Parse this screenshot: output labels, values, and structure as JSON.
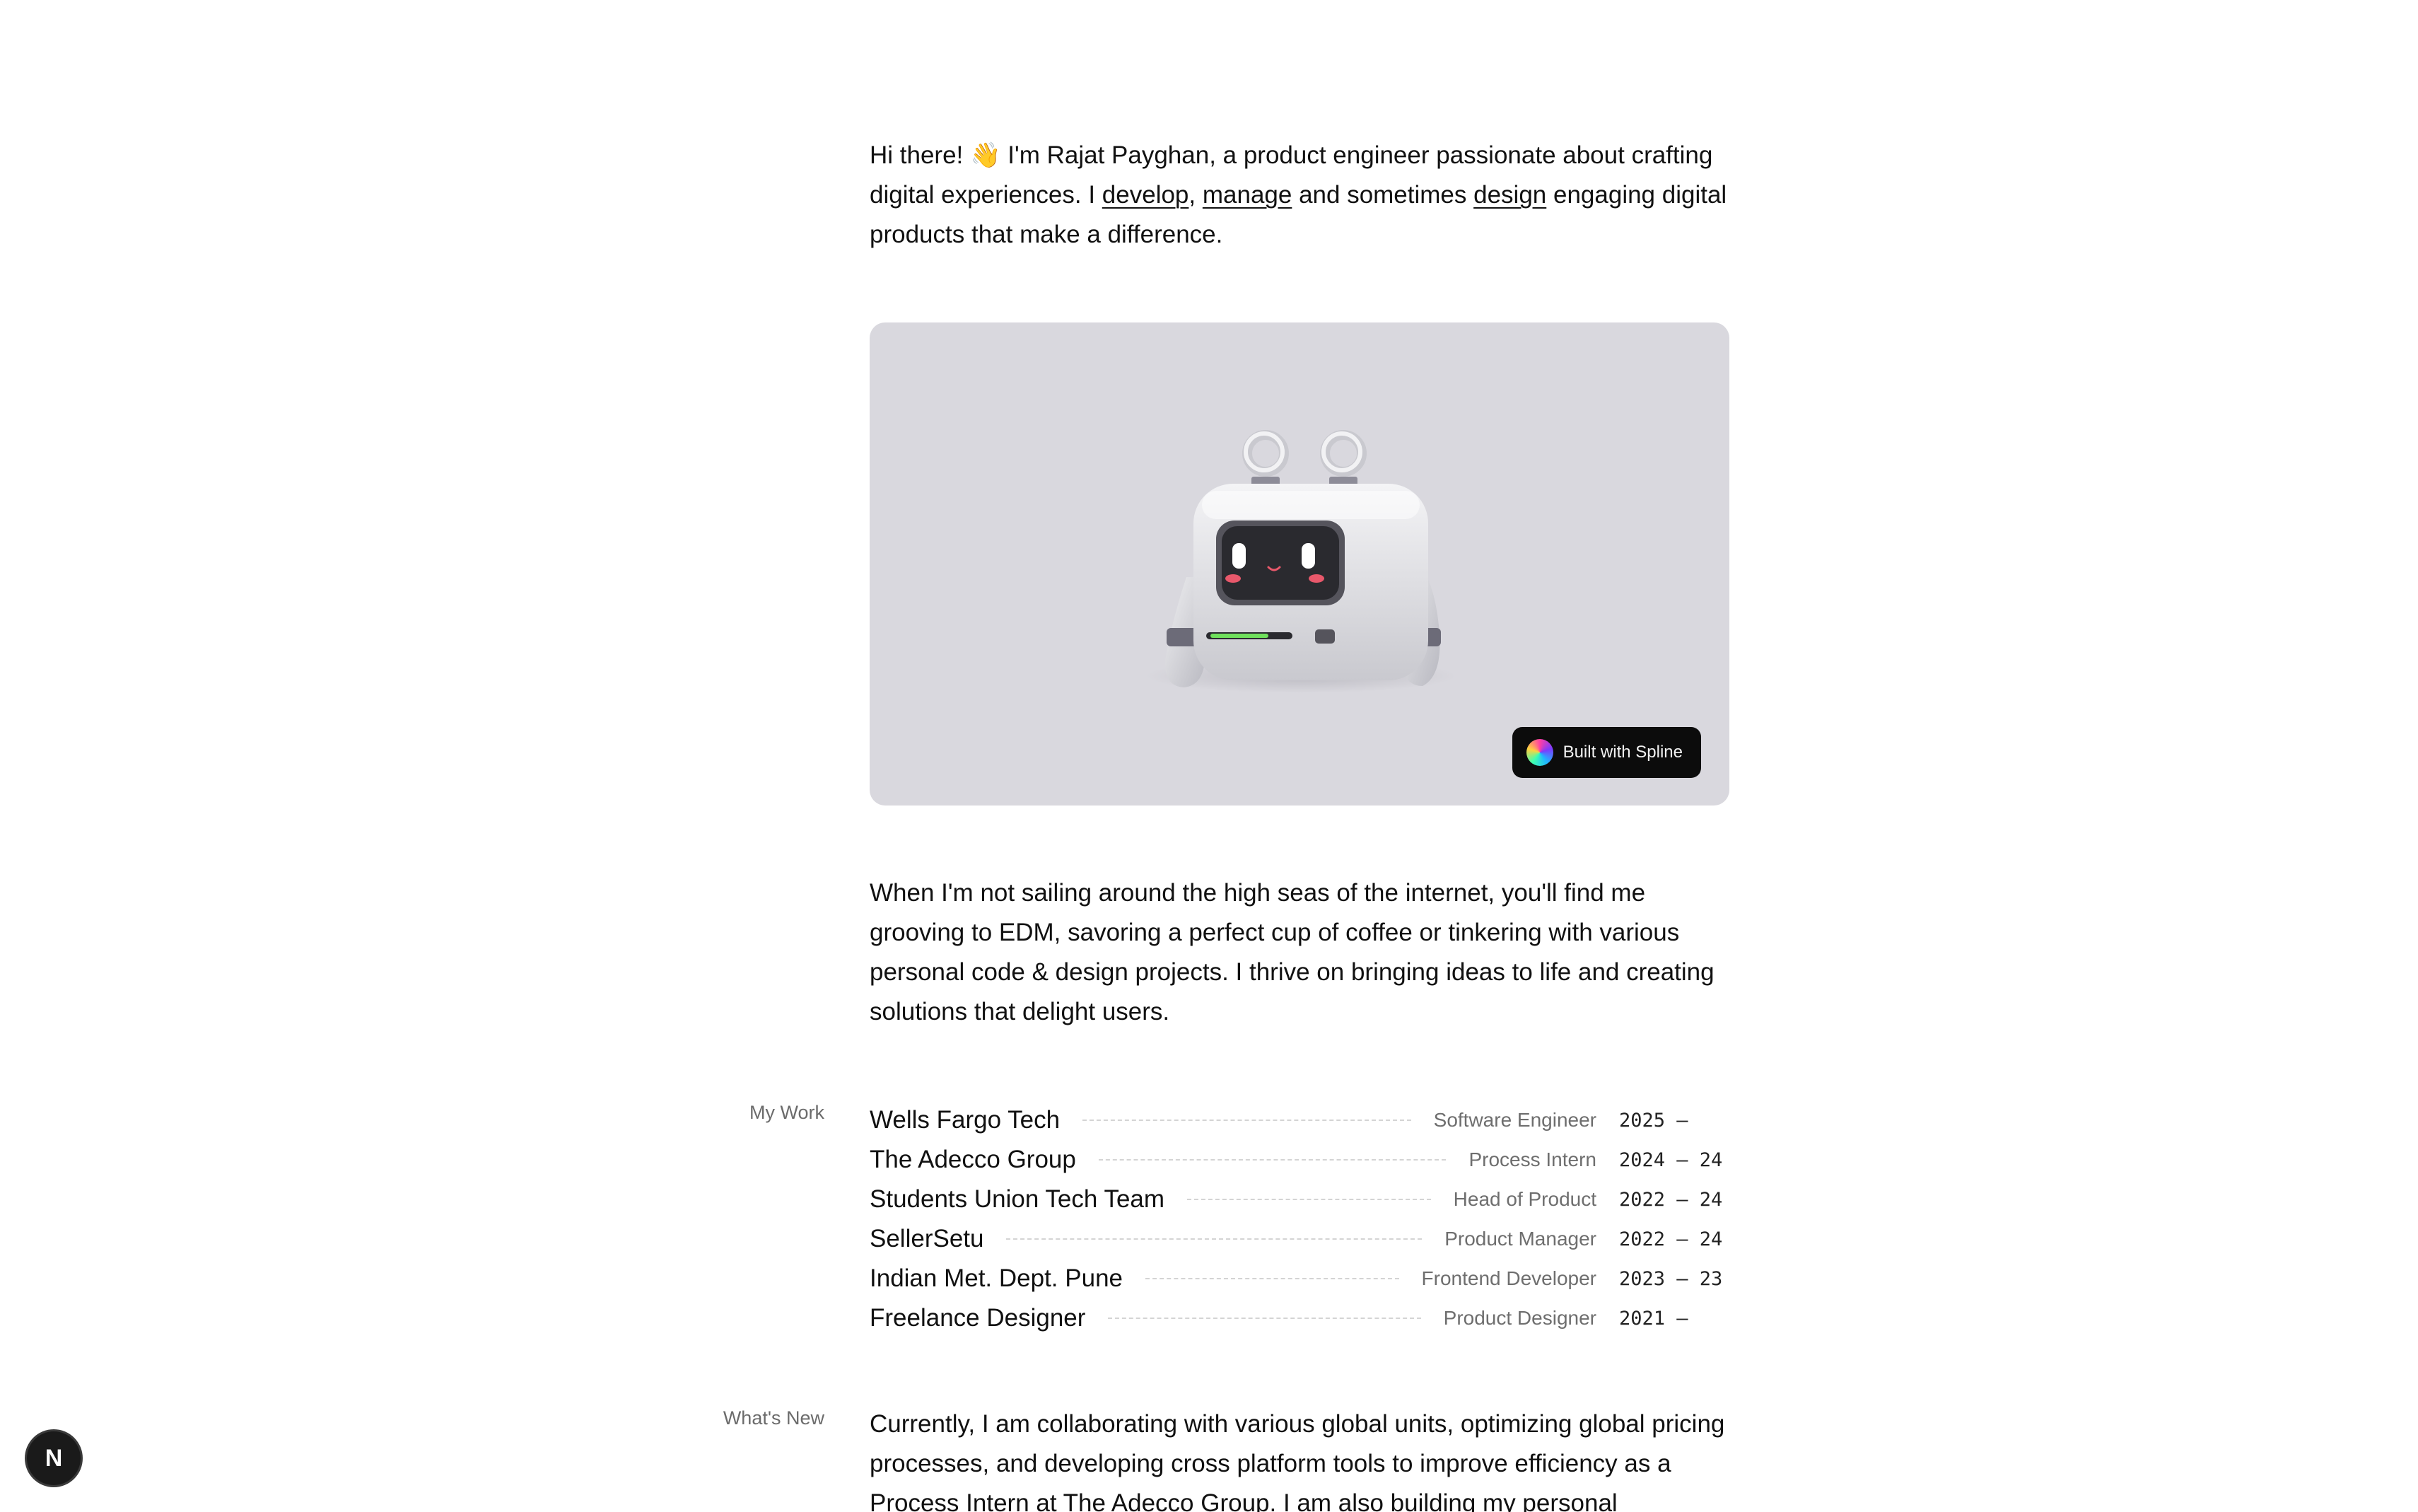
{
  "intro": {
    "part1": "Hi there! 👋 I'm Rajat Payghan, a product engineer passionate about crafting digital experiences. I ",
    "link_develop": "develop",
    "sep1": ", ",
    "link_manage": "manage",
    "part2": " and sometimes ",
    "link_design": "design",
    "part3": " engaging digital products that make a difference."
  },
  "hero": {
    "badge_label": "Built with Spline",
    "badge_icon": "spline-logo-icon",
    "robot_icon": "robot-illustration"
  },
  "about": {
    "text": "When I'm not sailing around the high seas of the internet, you'll find me grooving to EDM, savoring a perfect cup of coffee or tinkering with various personal code & design projects. I thrive on bringing ideas to life and creating solutions that delight users."
  },
  "work": {
    "label": "My Work",
    "items": [
      {
        "company": "Wells Fargo Tech",
        "role": "Software Engineer",
        "years": "2025 —"
      },
      {
        "company": "The Adecco Group",
        "role": "Process Intern",
        "years": "2024 — 24"
      },
      {
        "company": "Students Union Tech Team",
        "role": "Head of Product",
        "years": "2022 — 24"
      },
      {
        "company": "SellerSetu",
        "role": "Product Manager",
        "years": "2022 — 24"
      },
      {
        "company": "Indian Met. Dept. Pune",
        "role": "Frontend Developer",
        "years": "2023 — 23"
      },
      {
        "company": "Freelance Designer",
        "role": "Product Designer",
        "years": "2021 —"
      }
    ]
  },
  "news": {
    "label": "What's New",
    "text": "Currently, I am collaborating with various global units, optimizing global pricing processes, and developing cross platform tools to improve efficiency as a Process Intern at The Adecco Group. I am also building my personal"
  },
  "corner_badge": {
    "letter": "N",
    "icon": "nextjs-icon"
  },
  "colors": {
    "background": "#ffffff",
    "hero_background": "#d9d8de",
    "text": "#111111",
    "muted": "#6b6b6b"
  }
}
